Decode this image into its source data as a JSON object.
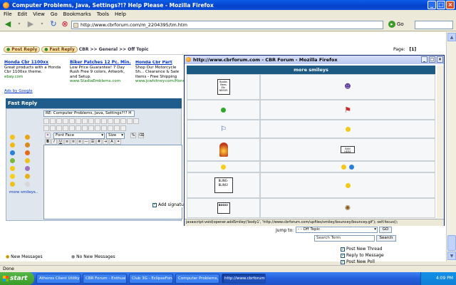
{
  "window": {
    "title": "Computer Problems, Java, Settings?!? Help Please - Mozilla Firefox"
  },
  "menu": [
    "File",
    "Edit",
    "View",
    "Go",
    "Bookmarks",
    "Tools",
    "Help"
  ],
  "nav": {
    "url": "http://www.cbrforum.com/m_2204395/tm.htm",
    "go_label": "Go"
  },
  "forum": {
    "post_reply": "Post Reply",
    "fast_reply": "Fast Reply",
    "breadcrumb": "CBR >> General >> Off Topic",
    "page_label": "Page:",
    "page_num": "[1]",
    "ads": [
      {
        "title": "Honda Cbr 1100xx",
        "text": "Great products with a Honda Cbr 1100xx theme.",
        "url": "ebay.com"
      },
      {
        "title": "Biker Patches 12 Pc. Min.",
        "text": "Low Price Guarantee! 7 Day Rush Free 9 colors, Artwork, and Setup.",
        "url": "www.StadiaEmblems.com"
      },
      {
        "title": "Honda Cbr Part",
        "text": "Shop Our Motorcycle Sh... Clearance & Sale Items - Free Shipping",
        "url": "www.jcwhitney.com/Hond..."
      }
    ],
    "ads_by": "Ads by Google",
    "fast_reply_header": "Fast Reply",
    "subject": "RE: Computer Problems, Java, Settings?!? H",
    "font_face": "Font Face",
    "size": "Size",
    "more_smileys": "more smileys..",
    "add_signature": "Add signatu",
    "jump_label": "Jump to:",
    "jump_value": "- - Off Topic",
    "go_btn": "GO",
    "search_value": "Search Term",
    "search_btn": "Search",
    "new_messages": "New Messages",
    "no_new_messages": "No New Messages",
    "options": [
      "Post New Thread",
      "Reply to Message",
      "Post New Poll"
    ]
  },
  "popup": {
    "title": "http://www.cbrforum.com - CBR Forum - Mozilla Firefox",
    "header": "more smileys",
    "signs": [
      "Boobs Bees Etc NEEDS",
      "BLING-BLING!",
      "BOOO!",
      "BAN HERE"
    ],
    "status": "javascript:void(opener.addSmiley('body1', 'http://www.cbrforum.com/upfiles/smiley/bouncey/bouncey.gif'); self.focus();"
  },
  "status": {
    "text": "Done"
  },
  "taskbar": {
    "start": "start",
    "tasks": [
      "Atheros Client Utility ...",
      "CBR Forum - Enthusia...",
      "Club 3G - EclipseForu...",
      "Computer Problems, ...",
      "http://www.cbrforum..."
    ],
    "clock": "4:09 PM"
  }
}
